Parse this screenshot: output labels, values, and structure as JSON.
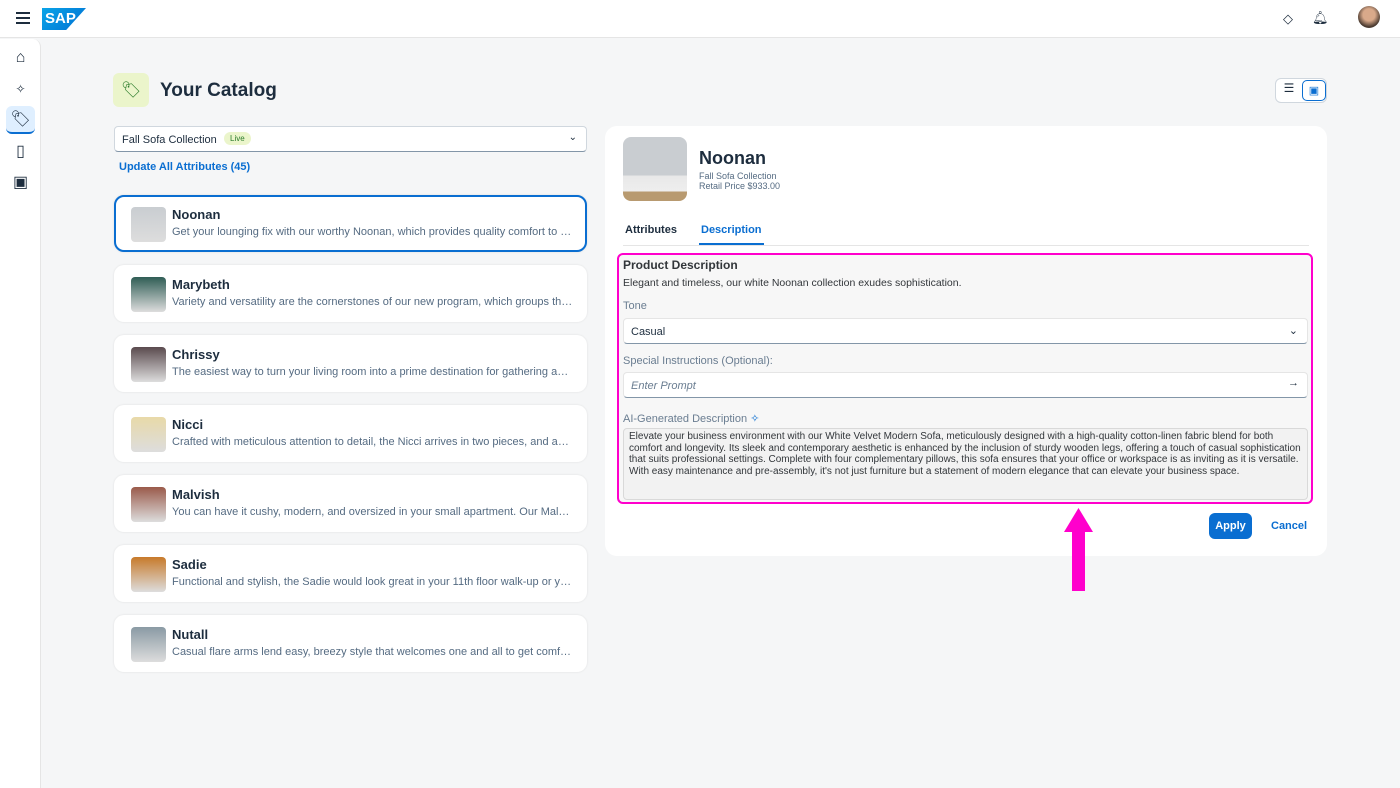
{
  "shell": {
    "logo": "SAP"
  },
  "sidebar": {
    "items": [
      {
        "name": "home"
      },
      {
        "name": "ai"
      },
      {
        "name": "catalog",
        "active": true
      },
      {
        "name": "documents"
      },
      {
        "name": "gallery"
      }
    ]
  },
  "page": {
    "title": "Your Catalog",
    "collection": "Fall Sofa Collection",
    "badge": "Live",
    "update_link": "Update All Attributes (45)"
  },
  "products": [
    {
      "name": "Noonan",
      "desc": "Get your lounging fix with our worthy Noonan, which provides quality comfort to match...",
      "color": "#c9cdd1"
    },
    {
      "name": "Marybeth",
      "desc": "Variety and versatility are the cornerstones of our new program, which groups three inv...",
      "color": "#2f5d55"
    },
    {
      "name": "Chrissy",
      "desc": "The easiest way to turn your living room into a prime destination for gathering and loun...",
      "color": "#5a4a4e"
    },
    {
      "name": "Nicci",
      "desc": "Crafted with meticulous attention to detail, the Nicci arrives in two pieces, and as such...",
      "color": "#e8d9a8"
    },
    {
      "name": "Malvish",
      "desc": "You can have it cushy, modern, and oversized in your small apartment. Our Malvish co...",
      "color": "#9a5a4a"
    },
    {
      "name": "Sadie",
      "desc": "Functional and stylish, the Sadie would look great in your 11th floor walk-up or your sp...",
      "color": "#c77a2a"
    },
    {
      "name": "Nutall",
      "desc": "Casual flare arms lend easy, breezy style that welcomes one and all to get comfortabl...",
      "color": "#8a9aa4"
    }
  ],
  "detail": {
    "name": "Noonan",
    "collection": "Fall Sofa Collection",
    "price": "Retail Price $933.00",
    "tabs": [
      "Attributes",
      "Description"
    ],
    "section_title": "Product Description",
    "summary": "Elegant and timeless, our white Noonan collection exudes sophistication.",
    "tone_label": "Tone",
    "tone_value": "Casual",
    "instructions_label": "Special Instructions (Optional):",
    "prompt_placeholder": "Enter Prompt",
    "ai_label": "AI-Generated Description",
    "ai_text": "Elevate your business environment with our White Velvet Modern Sofa, meticulously designed with a high-quality cotton-linen fabric blend for both comfort and longevity. Its sleek and contemporary aesthetic is enhanced by the inclusion of sturdy wooden legs, offering a touch of casual sophistication that suits professional settings. Complete with four complementary pillows, this sofa ensures that your office or workspace is as inviting as it is versatile. With easy maintenance and pre-assembly, it's not just furniture but a statement of modern elegance that can elevate your business space.",
    "apply": "Apply",
    "cancel": "Cancel"
  },
  "colors": {
    "accent": "#0a6ed1",
    "highlight": "#ff00cc"
  }
}
